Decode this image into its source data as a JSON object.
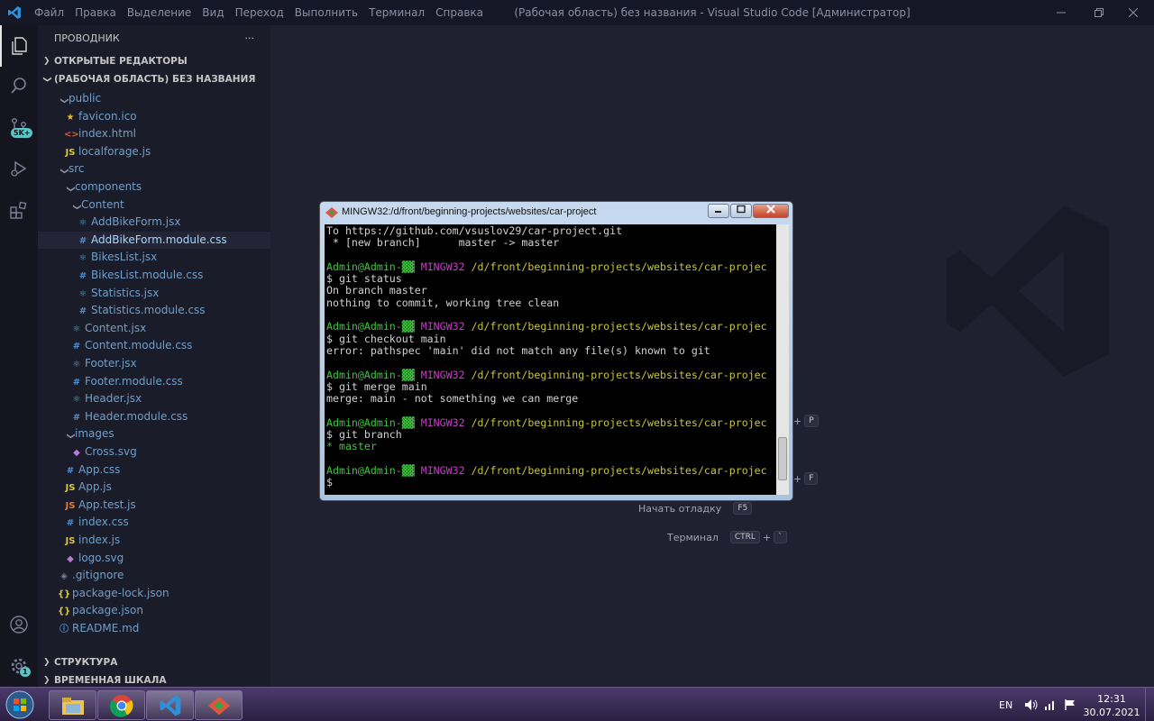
{
  "titlebar": {
    "menu": [
      "Файл",
      "Правка",
      "Выделение",
      "Вид",
      "Переход",
      "Выполнить",
      "Терминал",
      "Справка"
    ],
    "window_title": "(Рабочая область) без названия - Visual Studio Code [Администратор]"
  },
  "activity": {
    "source_control_badge": "5K+",
    "settings_badge": "1"
  },
  "sidebar": {
    "header": "ПРОВОДНИК",
    "more": "···",
    "open_editors": "ОТКРЫТЫЕ РЕДАКТОРЫ",
    "workspace": "(РАБОЧАЯ ОБЛАСТЬ) БЕЗ НАЗВАНИЯ",
    "outline": "СТРУКТУРА",
    "timeline": "ВРЕМЕННАЯ ШКАЛА",
    "tree": [
      {
        "label": "public",
        "type": "folder",
        "indent": 0
      },
      {
        "label": "favicon.ico",
        "type": "ico",
        "indent": 1
      },
      {
        "label": "index.html",
        "type": "html",
        "indent": 1
      },
      {
        "label": "localforage.js",
        "type": "js",
        "indent": 1
      },
      {
        "label": "src",
        "type": "folder",
        "indent": 0
      },
      {
        "label": "components",
        "type": "folder",
        "indent": 1
      },
      {
        "label": "Content",
        "type": "folder",
        "indent": 2
      },
      {
        "label": "AddBikeForm.jsx",
        "type": "jsx",
        "indent": 3
      },
      {
        "label": "AddBikeForm.module.css",
        "type": "css",
        "indent": 3,
        "selected": true
      },
      {
        "label": "BikesList.jsx",
        "type": "jsx",
        "indent": 3
      },
      {
        "label": "BikesList.module.css",
        "type": "css",
        "indent": 3
      },
      {
        "label": "Statistics.jsx",
        "type": "jsx",
        "indent": 3
      },
      {
        "label": "Statistics.module.css",
        "type": "css",
        "indent": 3
      },
      {
        "label": "Content.jsx",
        "type": "jsx",
        "indent": 2
      },
      {
        "label": "Content.module.css",
        "type": "css",
        "indent": 2
      },
      {
        "label": "Footer.jsx",
        "type": "jsx",
        "indent": 2
      },
      {
        "label": "Footer.module.css",
        "type": "css",
        "indent": 2
      },
      {
        "label": "Header.jsx",
        "type": "jsx",
        "indent": 2
      },
      {
        "label": "Header.module.css",
        "type": "css",
        "indent": 2
      },
      {
        "label": "images",
        "type": "folder",
        "indent": 1
      },
      {
        "label": "Cross.svg",
        "type": "svg",
        "indent": 2
      },
      {
        "label": "App.css",
        "type": "css",
        "indent": 1
      },
      {
        "label": "App.js",
        "type": "js",
        "indent": 1
      },
      {
        "label": "App.test.js",
        "type": "jstest",
        "indent": 1
      },
      {
        "label": "index.css",
        "type": "css",
        "indent": 1
      },
      {
        "label": "index.js",
        "type": "js",
        "indent": 1
      },
      {
        "label": "logo.svg",
        "type": "svg",
        "indent": 1
      },
      {
        "label": ".gitignore",
        "type": "git",
        "indent": 0
      },
      {
        "label": "package-lock.json",
        "type": "json",
        "indent": 0
      },
      {
        "label": "package.json",
        "type": "json",
        "indent": 0
      },
      {
        "label": "README.md",
        "type": "md",
        "indent": 0
      }
    ]
  },
  "editor": {
    "shortcuts": [
      {
        "label": "",
        "keys": [
          "P"
        ]
      },
      {
        "label": "",
        "keys": [
          "F"
        ]
      },
      {
        "label": "Начать отладку",
        "keys": [
          "F5"
        ]
      },
      {
        "label": "Терминал",
        "keys": [
          "CTRL",
          "`"
        ]
      }
    ]
  },
  "terminal": {
    "title": "MINGW32:/d/front/beginning-projects/websites/car-project",
    "prompt_user": "Admin@Admin-",
    "prompt_host": "MINGW32",
    "prompt_path": "/d/front/beginning-projects/websites/car-projec",
    "lines": [
      {
        "kind": "out",
        "text": "To https://github.com/vsuslov29/car-project.git"
      },
      {
        "kind": "out",
        "text": " * [new branch]      master -> master"
      },
      {
        "kind": "blank",
        "text": ""
      },
      {
        "kind": "prompt",
        "text": ""
      },
      {
        "kind": "out",
        "text": "$ git status"
      },
      {
        "kind": "out",
        "text": "On branch master"
      },
      {
        "kind": "out",
        "text": "nothing to commit, working tree clean"
      },
      {
        "kind": "blank",
        "text": ""
      },
      {
        "kind": "prompt",
        "text": ""
      },
      {
        "kind": "out",
        "text": "$ git checkout main"
      },
      {
        "kind": "out",
        "text": "error: pathspec 'main' did not match any file(s) known to git"
      },
      {
        "kind": "blank",
        "text": ""
      },
      {
        "kind": "prompt",
        "text": ""
      },
      {
        "kind": "out",
        "text": "$ git merge main"
      },
      {
        "kind": "out",
        "text": "merge: main - not something we can merge"
      },
      {
        "kind": "blank",
        "text": ""
      },
      {
        "kind": "prompt",
        "text": ""
      },
      {
        "kind": "out",
        "text": "$ git branch"
      },
      {
        "kind": "green",
        "text": "* master"
      },
      {
        "kind": "blank",
        "text": ""
      },
      {
        "kind": "prompt",
        "text": ""
      },
      {
        "kind": "out",
        "text": "$"
      }
    ]
  },
  "taskbar": {
    "lang": "EN",
    "time": "12:31",
    "date": "30.07.2021"
  },
  "colors": {
    "terminal_green": "#3fc53f",
    "terminal_magenta": "#c53fc5",
    "terminal_yellow": "#c5c53f",
    "vscode_blue": "#2f8fd8"
  }
}
